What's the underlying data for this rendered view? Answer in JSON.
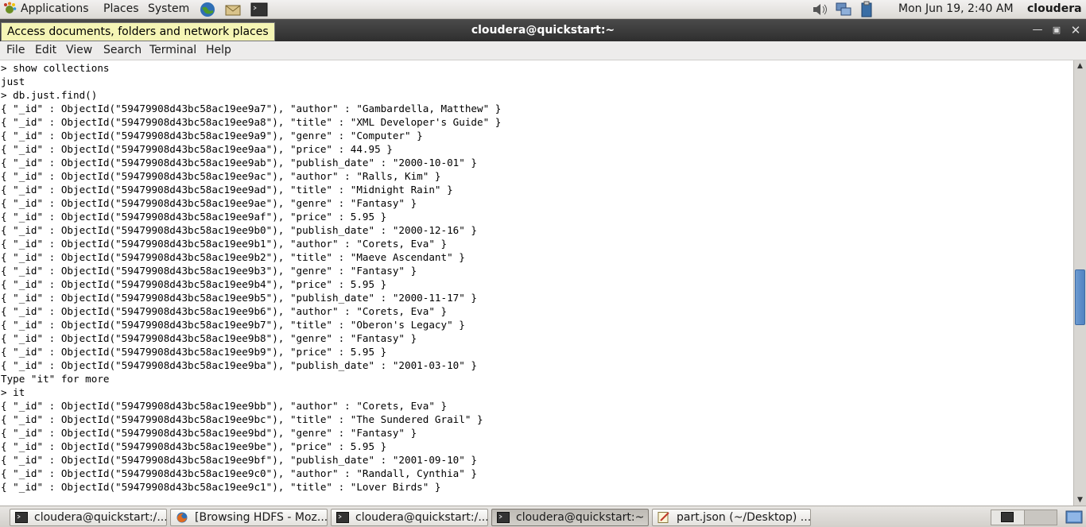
{
  "top_panel": {
    "menus": [
      "Applications",
      "Places",
      "System"
    ],
    "clock": "Mon Jun 19,  2:40 AM",
    "user": "cloudera"
  },
  "window": {
    "title": "cloudera@quickstart:~",
    "tooltip": "Access documents, folders and network places"
  },
  "menubar": [
    "File",
    "Edit",
    "View",
    "Search",
    "Terminal",
    "Help"
  ],
  "terminal_lines": [
    "> show collections",
    "just",
    "> db.just.find()",
    "{ \"_id\" : ObjectId(\"59479908d43bc58ac19ee9a7\"), \"author\" : \"Gambardella, Matthew\" }",
    "{ \"_id\" : ObjectId(\"59479908d43bc58ac19ee9a8\"), \"title\" : \"XML Developer's Guide\" }",
    "{ \"_id\" : ObjectId(\"59479908d43bc58ac19ee9a9\"), \"genre\" : \"Computer\" }",
    "{ \"_id\" : ObjectId(\"59479908d43bc58ac19ee9aa\"), \"price\" : 44.95 }",
    "{ \"_id\" : ObjectId(\"59479908d43bc58ac19ee9ab\"), \"publish_date\" : \"2000-10-01\" }",
    "{ \"_id\" : ObjectId(\"59479908d43bc58ac19ee9ac\"), \"author\" : \"Ralls, Kim\" }",
    "{ \"_id\" : ObjectId(\"59479908d43bc58ac19ee9ad\"), \"title\" : \"Midnight Rain\" }",
    "{ \"_id\" : ObjectId(\"59479908d43bc58ac19ee9ae\"), \"genre\" : \"Fantasy\" }",
    "{ \"_id\" : ObjectId(\"59479908d43bc58ac19ee9af\"), \"price\" : 5.95 }",
    "{ \"_id\" : ObjectId(\"59479908d43bc58ac19ee9b0\"), \"publish_date\" : \"2000-12-16\" }",
    "{ \"_id\" : ObjectId(\"59479908d43bc58ac19ee9b1\"), \"author\" : \"Corets, Eva\" }",
    "{ \"_id\" : ObjectId(\"59479908d43bc58ac19ee9b2\"), \"title\" : \"Maeve Ascendant\" }",
    "{ \"_id\" : ObjectId(\"59479908d43bc58ac19ee9b3\"), \"genre\" : \"Fantasy\" }",
    "{ \"_id\" : ObjectId(\"59479908d43bc58ac19ee9b4\"), \"price\" : 5.95 }",
    "{ \"_id\" : ObjectId(\"59479908d43bc58ac19ee9b5\"), \"publish_date\" : \"2000-11-17\" }",
    "{ \"_id\" : ObjectId(\"59479908d43bc58ac19ee9b6\"), \"author\" : \"Corets, Eva\" }",
    "{ \"_id\" : ObjectId(\"59479908d43bc58ac19ee9b7\"), \"title\" : \"Oberon's Legacy\" }",
    "{ \"_id\" : ObjectId(\"59479908d43bc58ac19ee9b8\"), \"genre\" : \"Fantasy\" }",
    "{ \"_id\" : ObjectId(\"59479908d43bc58ac19ee9b9\"), \"price\" : 5.95 }",
    "{ \"_id\" : ObjectId(\"59479908d43bc58ac19ee9ba\"), \"publish_date\" : \"2001-03-10\" }",
    "Type \"it\" for more",
    "> it",
    "{ \"_id\" : ObjectId(\"59479908d43bc58ac19ee9bb\"), \"author\" : \"Corets, Eva\" }",
    "{ \"_id\" : ObjectId(\"59479908d43bc58ac19ee9bc\"), \"title\" : \"The Sundered Grail\" }",
    "{ \"_id\" : ObjectId(\"59479908d43bc58ac19ee9bd\"), \"genre\" : \"Fantasy\" }",
    "{ \"_id\" : ObjectId(\"59479908d43bc58ac19ee9be\"), \"price\" : 5.95 }",
    "{ \"_id\" : ObjectId(\"59479908d43bc58ac19ee9bf\"), \"publish_date\" : \"2001-09-10\" }",
    "{ \"_id\" : ObjectId(\"59479908d43bc58ac19ee9c0\"), \"author\" : \"Randall, Cynthia\" }",
    "{ \"_id\" : ObjectId(\"59479908d43bc58ac19ee9c1\"), \"title\" : \"Lover Birds\" }"
  ],
  "taskbar": [
    {
      "label": "cloudera@quickstart:/...",
      "icon": "terminal-icon",
      "active": false
    },
    {
      "label": "[Browsing HDFS - Moz...",
      "icon": "firefox-icon",
      "active": false
    },
    {
      "label": "cloudera@quickstart:/...",
      "icon": "terminal-icon",
      "active": false
    },
    {
      "label": "cloudera@quickstart:~",
      "icon": "terminal-icon",
      "active": true
    },
    {
      "label": "part.json (~/Desktop) ...",
      "icon": "text-editor-icon",
      "active": false
    }
  ],
  "scrollbar": {
    "thumb_position_fraction": 0.54
  },
  "colors": {
    "titlebar": "#3a3a3a",
    "tooltip_bg": "#f5f5b5",
    "scroll_thumb": "#5a8cc8"
  }
}
